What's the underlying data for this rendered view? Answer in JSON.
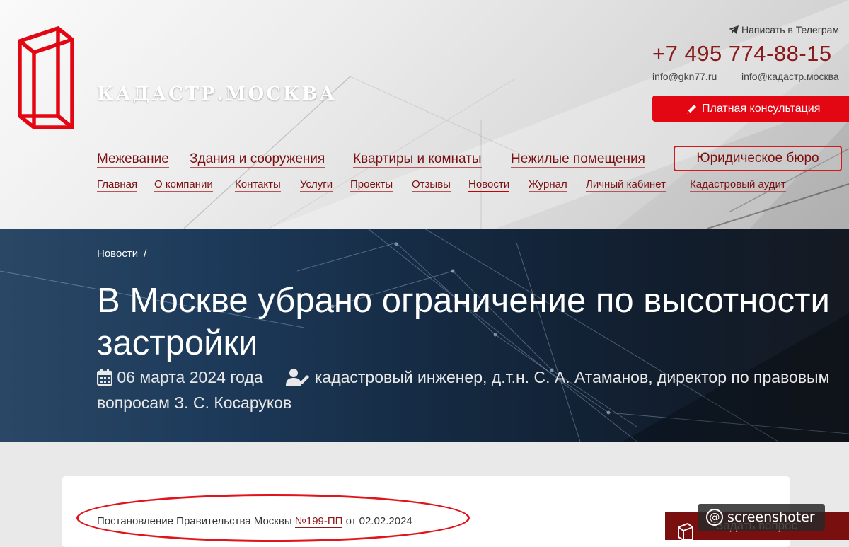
{
  "brand": {
    "name": "КАДАСТР.МОСКВА",
    "accent": "#e30613",
    "dark_red": "#8b1a1a"
  },
  "contacts": {
    "telegram_label": "Написать в Телеграм",
    "phone": "+7 495 774-88-15",
    "email1": "info@gkn77.ru",
    "email2": "info@кадастр.москва"
  },
  "consult_button": {
    "label": "Платная консультация",
    "icon": "pencil-icon"
  },
  "main_nav": [
    {
      "label": "Межевание"
    },
    {
      "label": "Здания и сооружения"
    },
    {
      "label": "Квартиры и комнаты"
    },
    {
      "label": "Нежилые помещения"
    }
  ],
  "legal_button": {
    "label": "Юридическое бюро"
  },
  "sub_nav": [
    {
      "label": "Главная"
    },
    {
      "label": "О компании"
    },
    {
      "label": "Контакты"
    },
    {
      "label": "Услуги"
    },
    {
      "label": "Проекты"
    },
    {
      "label": "Отзывы"
    },
    {
      "label": "Новости",
      "active": true
    },
    {
      "label": "Журнал"
    },
    {
      "label": "Личный кабинет"
    },
    {
      "label": "Кадастровый аудит"
    }
  ],
  "breadcrumb": {
    "item": "Новости",
    "separator": "/"
  },
  "article": {
    "title": "В Москве убрано ограничение по высотности застройки",
    "date": "06 марта 2024 года",
    "author": "кадастровый инженер, д.т.н. С. А. Атаманов, директор по правовым вопросам З. С. Косаруков",
    "date_icon": "calendar-icon",
    "author_icon": "user-edit-icon"
  },
  "content": {
    "decree_prefix": "Постановление Правительства Москвы ",
    "decree_link": "№199-ПП",
    "decree_suffix": " от 02.02.2024"
  },
  "ask_widget": {
    "label": "Задать вопрос"
  },
  "watermark": {
    "at": "@",
    "text": "screenshoter"
  }
}
